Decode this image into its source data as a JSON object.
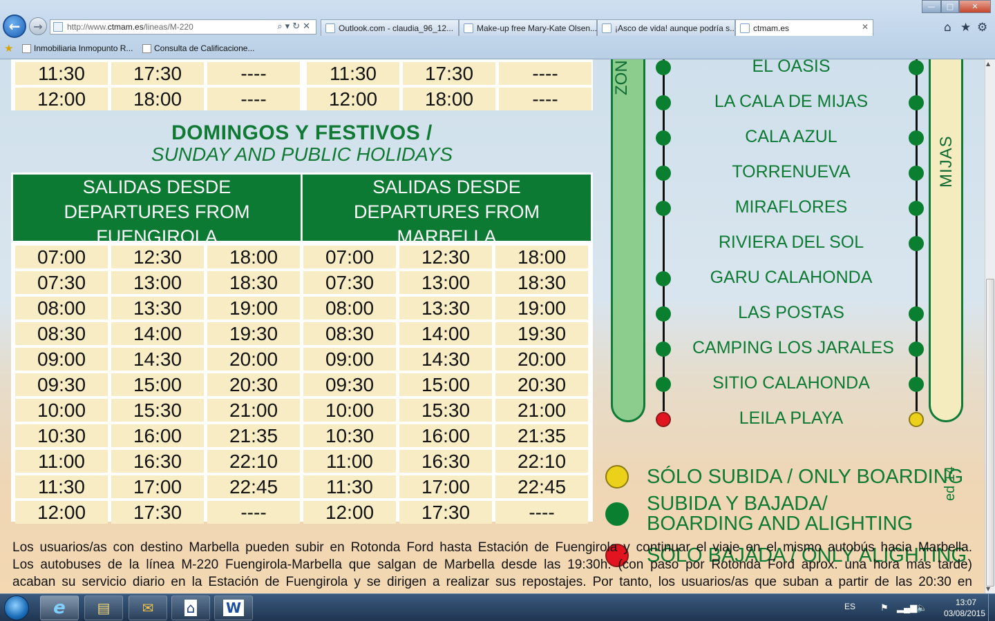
{
  "browser": {
    "address": {
      "prefix": "http://www.",
      "domain": "ctmam.es",
      "path": "/lineas/M-220"
    },
    "tabs": [
      {
        "label": "Outlook.com - claudia_96_12..."
      },
      {
        "label": "Make-up free Mary-Kate Olsen..."
      },
      {
        "label": "¡Asco de vida! aunque podría s..."
      },
      {
        "label": "ctmam.es"
      }
    ],
    "favorites": [
      {
        "label": "Inmobiliaria Inmopunto R..."
      },
      {
        "label": "Consulta de Calificacione..."
      }
    ],
    "window_buttons": {
      "minimize": "—",
      "maximize": "□",
      "close": "✕"
    },
    "icons": {
      "home": "⌂",
      "favorites": "★",
      "tools": "⚙"
    }
  },
  "top_rows": [
    [
      "11:30",
      "17:30",
      "----",
      "11:30",
      "17:30",
      "----"
    ],
    [
      "12:00",
      "18:00",
      "----",
      "12:00",
      "18:00",
      "----"
    ]
  ],
  "sunday": {
    "title": "DOMINGOS Y FESTIVOS /",
    "subtitle": "SUNDAY AND PUBLIC HOLIDAYS",
    "header_fuengirola": [
      "SALIDAS DESDE",
      "DEPARTURES FROM",
      "FUENGIROLA"
    ],
    "header_marbella": [
      "SALIDAS DESDE",
      "DEPARTURES FROM",
      "MARBELLA"
    ],
    "rows": [
      [
        "07:00",
        "12:30",
        "18:00",
        "07:00",
        "12:30",
        "18:00"
      ],
      [
        "07:30",
        "13:00",
        "18:30",
        "07:30",
        "13:00",
        "18:30"
      ],
      [
        "08:00",
        "13:30",
        "19:00",
        "08:00",
        "13:30",
        "19:00"
      ],
      [
        "08:30",
        "14:00",
        "19:30",
        "08:30",
        "14:00",
        "19:30"
      ],
      [
        "09:00",
        "14:30",
        "20:00",
        "09:00",
        "14:30",
        "20:00"
      ],
      [
        "09:30",
        "15:00",
        "20:30",
        "09:30",
        "15:00",
        "20:30"
      ],
      [
        "10:00",
        "15:30",
        "21:00",
        "10:00",
        "15:30",
        "21:00"
      ],
      [
        "10:30",
        "16:00",
        "21:35",
        "10:30",
        "16:00",
        "21:35"
      ],
      [
        "11:00",
        "16:30",
        "22:10",
        "11:00",
        "16:30",
        "22:10"
      ],
      [
        "11:30",
        "17:00",
        "22:45",
        "11:30",
        "17:00",
        "22:45"
      ],
      [
        "12:00",
        "17:30",
        "----",
        "12:00",
        "17:30",
        "----"
      ]
    ]
  },
  "route": {
    "zone_left": "ZON",
    "zone_right": "MIJAS",
    "stops": [
      {
        "name": "EL OASIS",
        "left": "green",
        "right": "green"
      },
      {
        "name": "LA CALA DE MIJAS",
        "left": "green",
        "right": "green"
      },
      {
        "name": "CALA AZUL",
        "left": "green",
        "right": "green"
      },
      {
        "name": "TORRENUEVA",
        "left": "green",
        "right": "green"
      },
      {
        "name": "MIRAFLORES",
        "left": "green",
        "right": "green"
      },
      {
        "name": "RIVIERA DEL SOL",
        "left": "none",
        "right": "green"
      },
      {
        "name": "GARU CALAHONDA",
        "left": "green",
        "right": "none"
      },
      {
        "name": "LAS POSTAS",
        "left": "green",
        "right": "green"
      },
      {
        "name": "CAMPING LOS JARALES",
        "left": "green",
        "right": "green"
      },
      {
        "name": "SITIO CALAHONDA",
        "left": "green",
        "right": "green"
      },
      {
        "name": "LEILA PLAYA",
        "left": "red",
        "right": "yellow"
      }
    ],
    "colors": {
      "green": "#0a7f2f",
      "red": "#e2141f",
      "yellow": "#ecd11a",
      "brand": "#0d7a33"
    }
  },
  "legend": {
    "only_boarding": "SÓLO SUBIDA / ONLY BOARDING",
    "boarding_alighting_1": "SUBIDA Y BAJADA/",
    "boarding_alighting_2": "BOARDING AND ALIGHTING",
    "only_alighting": "SÓLO BAJADA / ONLY ALIGHTING",
    "edition": "ed 14"
  },
  "notes": [
    "Los usuarios/as con destino Marbella pueden subir en Rotonda Ford hasta Estación de Fuengirola y continuar el viaje en el mismo autobús hacia Marbella.",
    "Los autobuses de la línea M-220 Fuengirola-Marbella que salgan de Marbella desde las 19:30h. (con paso por Rotonda Ford aprox. una hora más tarde)",
    "acaban su servicio diario en la Estación de Fuengirola y se dirigen a realizar sus repostajes. Por tanto, los usuarios/as que suban a partir de las 20:30 en"
  ],
  "taskbar": {
    "language": "ES",
    "time": "13:07",
    "date": "03/08/2015",
    "apps": [
      {
        "icon": "e"
      },
      {
        "icon": "▤"
      },
      {
        "icon": "✉"
      },
      {
        "icon": "⌂"
      },
      {
        "icon": "W"
      }
    ]
  }
}
